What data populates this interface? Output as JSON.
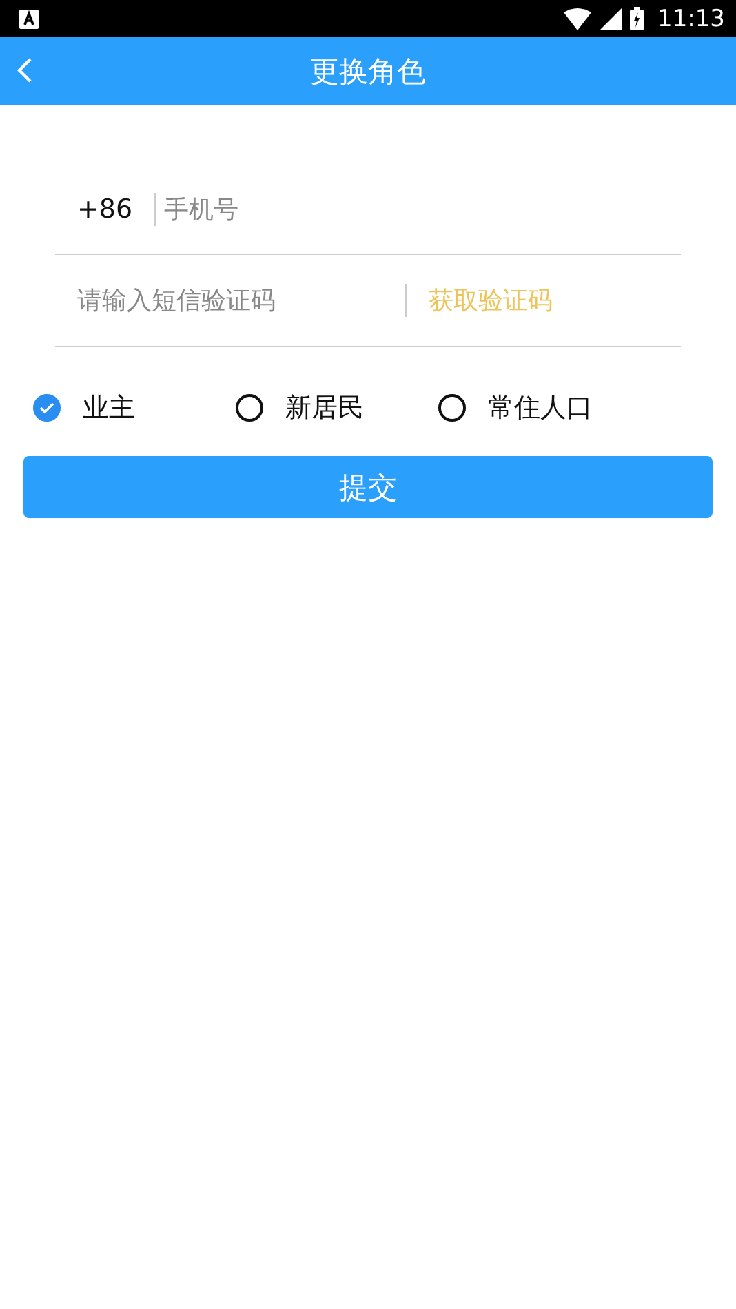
{
  "status_bar": {
    "time": "11:13"
  },
  "header": {
    "title": "更换角色"
  },
  "phone_field": {
    "prefix": "+86",
    "placeholder": "手机号"
  },
  "code_field": {
    "placeholder": "请输入短信验证码",
    "action": "获取验证码"
  },
  "roles": [
    {
      "label": "业主",
      "selected": true
    },
    {
      "label": "新居民",
      "selected": false
    },
    {
      "label": "常住人口",
      "selected": false
    }
  ],
  "submit": {
    "label": "提交"
  }
}
